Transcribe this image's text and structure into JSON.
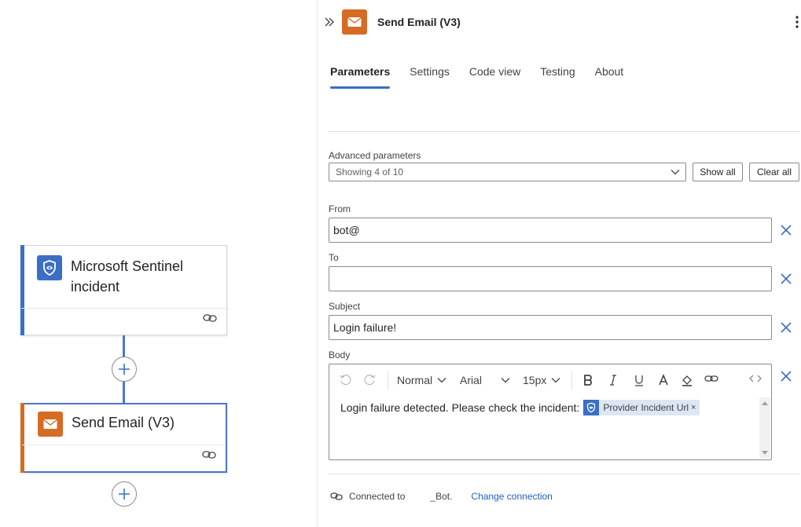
{
  "canvas": {
    "trigger_card": {
      "title": "Microsoft Sentinel incident",
      "icon": "shield-icon"
    },
    "action_card": {
      "title": "Send Email (V3)",
      "icon": "mail-icon"
    }
  },
  "panel": {
    "title": "Send Email (V3)",
    "tabs": [
      {
        "label": "Parameters",
        "active": true
      },
      {
        "label": "Settings",
        "active": false
      },
      {
        "label": "Code view",
        "active": false
      },
      {
        "label": "Testing",
        "active": false
      },
      {
        "label": "About",
        "active": false
      }
    ],
    "advanced": {
      "label": "Advanced parameters",
      "value": "Showing 4 of 10",
      "show_all": "Show all",
      "clear_all": "Clear all"
    },
    "fields": {
      "from": {
        "label": "From",
        "value": "bot@"
      },
      "to": {
        "label": "To",
        "value": ""
      },
      "subject": {
        "label": "Subject",
        "value": "Login failure!"
      }
    },
    "body": {
      "label": "Body",
      "toolbar": {
        "format": "Normal",
        "font": "Arial",
        "size": "15px"
      },
      "text": "Login failure detected. Please check the incident:",
      "token": {
        "label": "Provider Incident Url",
        "remove": "×"
      }
    },
    "connection": {
      "label": "Connected to",
      "name": "_Bot.",
      "change": "Change connection"
    }
  },
  "colors": {
    "accent": "#3a6fc4",
    "email_orange": "#d66b23",
    "link": "#1f5fbf"
  }
}
